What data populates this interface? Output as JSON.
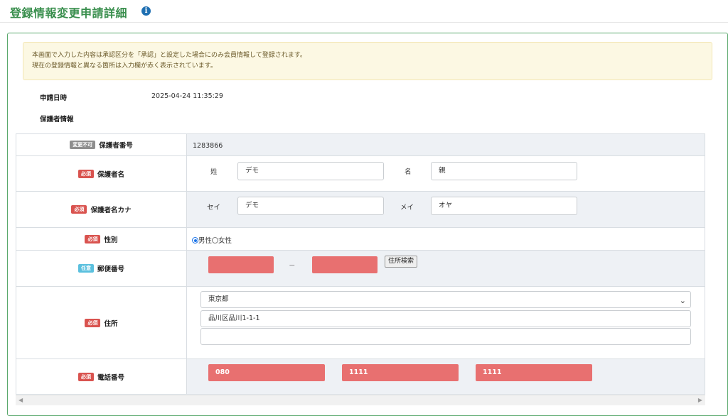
{
  "page": {
    "title": "登録情報変更申請詳細",
    "info_icon": "info-circle-icon"
  },
  "notice": {
    "line1": "本画面で入力した内容は承認区分を「承認」と設定した場合にのみ会員情報して登録されます。",
    "line2": "現在の登録情報と異なる箇所は入力欄が赤く表示されています。"
  },
  "meta": {
    "applied_at_label": "申請日時",
    "applied_at_value": "2025-04-24 11:35:29",
    "section_label": "保護者情報"
  },
  "badges": {
    "fixed": "変更不可",
    "required": "必須",
    "optional": "任意"
  },
  "rows": {
    "guardian_no": {
      "label": "保護者番号",
      "value": "1283866"
    },
    "guardian_name": {
      "label": "保護者名",
      "last_label": "姓",
      "last_value": "デモ",
      "first_label": "名",
      "first_value": "親"
    },
    "guardian_kana": {
      "label": "保護者名カナ",
      "last_label": "セイ",
      "last_value": "デモ",
      "first_label": "メイ",
      "first_value": "オヤ"
    },
    "gender": {
      "label": "性別",
      "option_male": "男性",
      "option_female": "女性",
      "selected": "男性"
    },
    "postal": {
      "label": "郵便番号",
      "part1": "",
      "dash": "－",
      "part2": "",
      "search_button": "住所検索"
    },
    "address": {
      "label": "住所",
      "prefecture": "東京都",
      "line1": "品川区品川1-1-1",
      "line2": ""
    },
    "phone": {
      "label": "電話番号",
      "part1": "080",
      "part2": "1111",
      "part3": "1111"
    }
  },
  "colors": {
    "title_green": "#3a8f4e",
    "error_red": "#e87070",
    "notice_bg": "#fcf8e3"
  }
}
